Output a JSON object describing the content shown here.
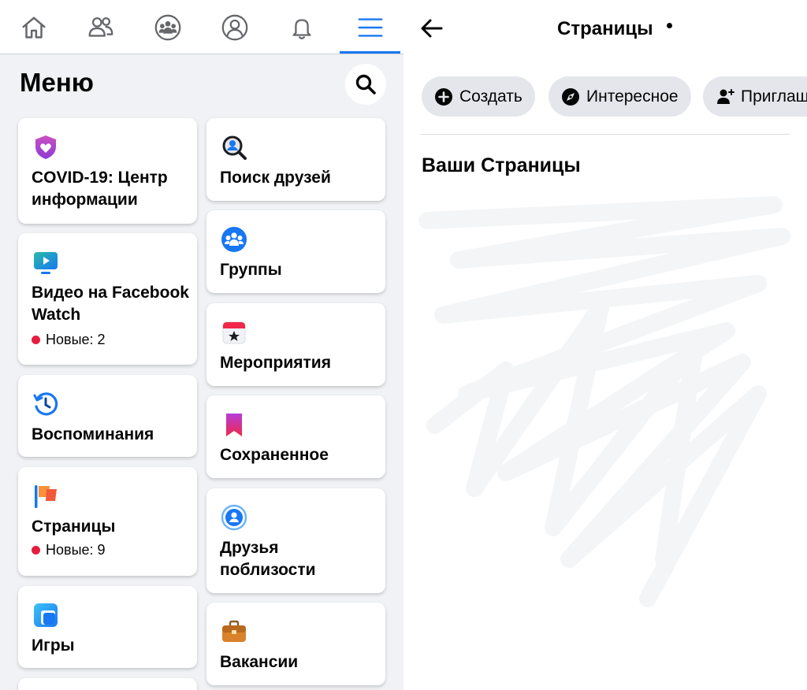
{
  "left": {
    "nav": {
      "items": [
        {
          "name": "home-icon"
        },
        {
          "name": "friends-icon"
        },
        {
          "name": "groups-icon"
        },
        {
          "name": "profile-icon"
        },
        {
          "name": "notifications-bell-icon"
        },
        {
          "name": "menu-hamburger-icon",
          "active": true
        }
      ],
      "accent": "#1877f2"
    },
    "menu_title": "Меню",
    "cards_left": [
      {
        "label": "COVID-19: Центр информации",
        "icon": "covid-heart-shield-icon"
      },
      {
        "label": "Видео на Facebook Watch",
        "icon": "watch-video-icon",
        "badge": "Новые: 2"
      },
      {
        "label": "Воспоминания",
        "icon": "memories-clock-icon"
      },
      {
        "label": "Страницы",
        "icon": "pages-flag-icon",
        "badge": "Новые: 9"
      },
      {
        "label": "Игры",
        "icon": "gaming-icon"
      }
    ],
    "cards_right": [
      {
        "label": "Поиск друзей",
        "icon": "find-friends-icon"
      },
      {
        "label": "Группы",
        "icon": "groups-icon"
      },
      {
        "label": "Мероприятия",
        "icon": "events-calendar-icon"
      },
      {
        "label": "Сохраненное",
        "icon": "saved-bookmark-icon"
      },
      {
        "label": "Друзья поблизости",
        "icon": "nearby-friends-icon"
      },
      {
        "label": "Вакансии",
        "icon": "jobs-briefcase-icon"
      }
    ],
    "badge_color": "#e41e3f"
  },
  "right": {
    "title": "Страницы",
    "chips": [
      {
        "label": "Создать",
        "icon": "plus-circle-icon"
      },
      {
        "label": "Интересное",
        "icon": "compass-icon"
      },
      {
        "label": "Приглаш",
        "icon": "invite-person-icon"
      }
    ],
    "section_title": "Ваши Страницы"
  }
}
